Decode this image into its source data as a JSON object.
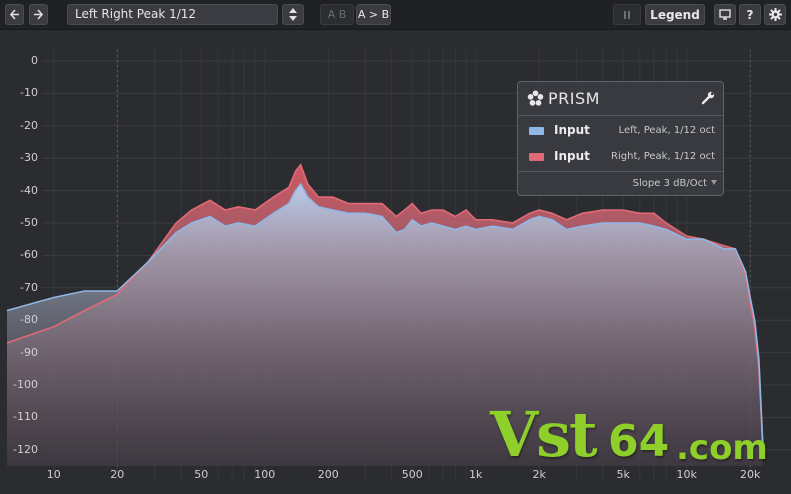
{
  "toolbar": {
    "back_icon": "arrow-left-icon",
    "forward_icon": "arrow-right-icon",
    "preset_name": "Left Right Peak 1/12",
    "ab_label": "A B",
    "copy_ab_label": "A > B",
    "freeze_icon": "pause-icon",
    "legend_label": "Legend",
    "display_icon": "monitor-icon",
    "help_label": "?",
    "settings_icon": "gear-icon"
  },
  "legend": {
    "title": "PRISM",
    "logo_icon": "prism-flower-icon",
    "wrench_icon": "wrench-icon",
    "rows": [
      {
        "name": "Input",
        "info": "Left, Peak, 1/12 oct",
        "color": "#8fb7e6"
      },
      {
        "name": "Input",
        "info": "Right, Peak, 1/12 oct",
        "color": "#e06a75"
      }
    ],
    "slope": "Slope 3 dB/Oct"
  },
  "axes": {
    "db_ticks": [
      "0",
      "-10",
      "-20",
      "-30",
      "-40",
      "-50",
      "-60",
      "-70",
      "-80",
      "-90",
      "-100",
      "-110",
      "-120"
    ],
    "freq_ticks": [
      {
        "label": "10",
        "hz": 10
      },
      {
        "label": "20",
        "hz": 20
      },
      {
        "label": "50",
        "hz": 50
      },
      {
        "label": "100",
        "hz": 100
      },
      {
        "label": "200",
        "hz": 200
      },
      {
        "label": "500",
        "hz": 500
      },
      {
        "label": "1k",
        "hz": 1000
      },
      {
        "label": "2k",
        "hz": 2000
      },
      {
        "label": "5k",
        "hz": 5000
      },
      {
        "label": "10k",
        "hz": 10000
      },
      {
        "label": "20k",
        "hz": 20000
      }
    ]
  },
  "spectrum": {
    "left": {
      "color": "#8fb7e6",
      "points": [
        [
          6,
          -77
        ],
        [
          10,
          -73
        ],
        [
          14,
          -71
        ],
        [
          20,
          -71
        ],
        [
          28,
          -62
        ],
        [
          38,
          -53
        ],
        [
          45,
          -50
        ],
        [
          55,
          -48
        ],
        [
          65,
          -51
        ],
        [
          75,
          -50
        ],
        [
          90,
          -51
        ],
        [
          110,
          -47
        ],
        [
          130,
          -44
        ],
        [
          140,
          -40
        ],
        [
          148,
          -38
        ],
        [
          160,
          -42
        ],
        [
          180,
          -45
        ],
        [
          210,
          -46
        ],
        [
          250,
          -47
        ],
        [
          300,
          -47
        ],
        [
          360,
          -48
        ],
        [
          420,
          -53
        ],
        [
          460,
          -52
        ],
        [
          500,
          -49
        ],
        [
          550,
          -51
        ],
        [
          620,
          -50
        ],
        [
          700,
          -51
        ],
        [
          800,
          -52
        ],
        [
          900,
          -51
        ],
        [
          1000,
          -52
        ],
        [
          1200,
          -51
        ],
        [
          1500,
          -52
        ],
        [
          1800,
          -49
        ],
        [
          2000,
          -48
        ],
        [
          2300,
          -49
        ],
        [
          2700,
          -52
        ],
        [
          3200,
          -51
        ],
        [
          4000,
          -50
        ],
        [
          5000,
          -50
        ],
        [
          6000,
          -50
        ],
        [
          7000,
          -51
        ],
        [
          8000,
          -52
        ],
        [
          10000,
          -55
        ],
        [
          12000,
          -55
        ],
        [
          15000,
          -58
        ],
        [
          17000,
          -58
        ],
        [
          19000,
          -65
        ],
        [
          20000,
          -73
        ],
        [
          21000,
          -80
        ],
        [
          22000,
          -92
        ],
        [
          23000,
          -120
        ]
      ]
    },
    "right": {
      "color": "#e06a75",
      "points": [
        [
          6,
          -87
        ],
        [
          10,
          -82
        ],
        [
          14,
          -77
        ],
        [
          20,
          -72
        ],
        [
          28,
          -62
        ],
        [
          38,
          -50
        ],
        [
          45,
          -46
        ],
        [
          55,
          -43
        ],
        [
          65,
          -46
        ],
        [
          75,
          -45
        ],
        [
          90,
          -46
        ],
        [
          110,
          -42
        ],
        [
          130,
          -39
        ],
        [
          140,
          -34
        ],
        [
          148,
          -32
        ],
        [
          160,
          -38
        ],
        [
          180,
          -42
        ],
        [
          210,
          -42
        ],
        [
          250,
          -44
        ],
        [
          300,
          -44
        ],
        [
          360,
          -44
        ],
        [
          420,
          -48
        ],
        [
          460,
          -46
        ],
        [
          500,
          -44
        ],
        [
          550,
          -47
        ],
        [
          620,
          -46
        ],
        [
          700,
          -46
        ],
        [
          800,
          -48
        ],
        [
          900,
          -46
        ],
        [
          1000,
          -49
        ],
        [
          1200,
          -49
        ],
        [
          1500,
          -50
        ],
        [
          1800,
          -47
        ],
        [
          2000,
          -46
        ],
        [
          2300,
          -47
        ],
        [
          2700,
          -49
        ],
        [
          3200,
          -47
        ],
        [
          4000,
          -46
        ],
        [
          5000,
          -46
        ],
        [
          6000,
          -47
        ],
        [
          7000,
          -47
        ],
        [
          8000,
          -50
        ],
        [
          10000,
          -54
        ],
        [
          12000,
          -55
        ],
        [
          15000,
          -57
        ],
        [
          17000,
          -58
        ],
        [
          19000,
          -66
        ],
        [
          20000,
          -75
        ],
        [
          21000,
          -82
        ],
        [
          22000,
          -95
        ],
        [
          23000,
          -120
        ]
      ]
    }
  },
  "watermark": {
    "vst": "Vst",
    "num": "64",
    "dotcom": ".com"
  }
}
